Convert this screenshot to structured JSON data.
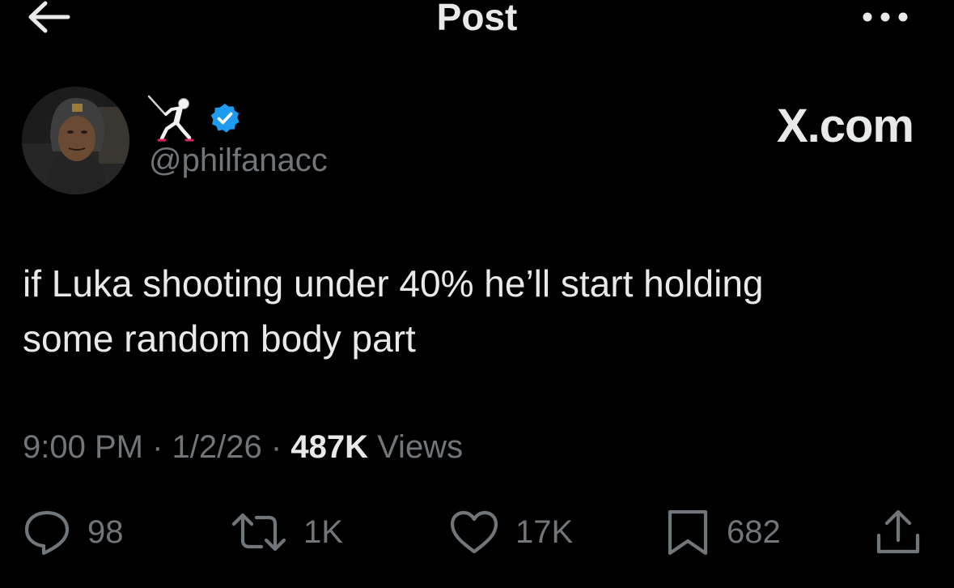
{
  "header": {
    "title": "Post",
    "back_icon": "arrow-left-icon",
    "more_icon": "more-dots-icon"
  },
  "author": {
    "display_name_emoji": "fencer-emoji",
    "verified_icon": "verified-badge-icon",
    "verified_color": "#1d9bf0",
    "handle": "@philfanacc"
  },
  "watermark": "X.com",
  "post": {
    "text_line1": "if Luka shooting under 40% he’ll start holding",
    "text_line2": "some random body part"
  },
  "meta": {
    "time": "9:00 PM",
    "separator": "·",
    "date": "1/2/26",
    "views_count": "487K",
    "views_label": "Views"
  },
  "actions": {
    "replies": "98",
    "reposts": "1K",
    "likes": "17K",
    "bookmarks": "682"
  },
  "colors": {
    "background": "#000000",
    "primary_text": "#e7e9ea",
    "secondary_text": "#71767b"
  }
}
